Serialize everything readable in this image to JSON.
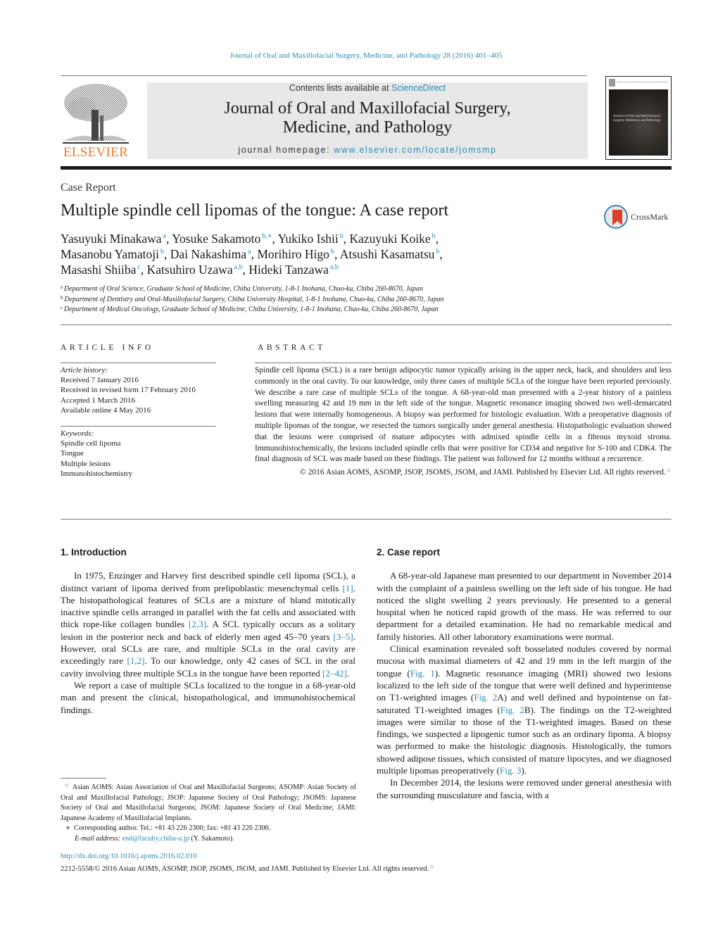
{
  "header": {
    "citation": "Journal of Oral and Maxillofacial Surgery, Medicine, and Pathology 28 (2016) 401–405",
    "publisher_logo_text": "ELSEVIER",
    "contents_prefix": "Contents lists available at ",
    "contents_link": "ScienceDirect",
    "journal_title_line1": "Journal of Oral and Maxillofacial Surgery,",
    "journal_title_line2": "Medicine, and Pathology",
    "homepage_prefix": "journal homepage: ",
    "homepage_link": "www.elsevier.com/locate/jomsmp",
    "cover_title": "Journal of Oral and Maxillofacial Surgery, Medicine, and Pathology"
  },
  "article": {
    "type_label": "Case Report",
    "title": "Multiple spindle cell lipomas of the tongue: A case report",
    "crossmark_label": "CrossMark",
    "authors": [
      {
        "name": "Yasuyuki Minakawa",
        "aff": "a",
        "sep": ", "
      },
      {
        "name": "Yosuke Sakamoto",
        "aff": "b,∗",
        "sep": ", "
      },
      {
        "name": "Yukiko Ishii",
        "aff": "b",
        "sep": ", "
      },
      {
        "name": "Kazuyuki Koike",
        "aff": "b",
        "sep": ","
      },
      {
        "name": "Masanobu Yamatoji",
        "aff": "b",
        "sep": ", "
      },
      {
        "name": "Dai Nakashima",
        "aff": "a",
        "sep": ", "
      },
      {
        "name": "Morihiro Higo",
        "aff": "b",
        "sep": ", "
      },
      {
        "name": "Atsushi Kasamatsu",
        "aff": "b",
        "sep": ","
      },
      {
        "name": "Masashi Shiiba",
        "aff": "c",
        "sep": ", "
      },
      {
        "name": "Katsuhiro Uzawa",
        "aff": "a,b",
        "sep": ", "
      },
      {
        "name": "Hideki Tanzawa",
        "aff": "a,b",
        "sep": ""
      }
    ],
    "affiliations": [
      {
        "key": "a",
        "text": "Department of Oral Science, Graduate School of Medicine, Chiba University, 1-8-1 Inohana, Chuo-ku, Chiba 260-8670, Japan"
      },
      {
        "key": "b",
        "text": "Department of Dentistry and Oral-Maxillofacial Surgery, Chiba University Hospital, 1-8-1 Inohana, Chuo-ku, Chiba 260-8670, Japan"
      },
      {
        "key": "c",
        "text": "Department of Medical Oncology, Graduate School of Medicine, Chiba University, 1-8-1 Inohana, Chuo-ku, Chiba 260-8670, Japan"
      }
    ]
  },
  "article_info": {
    "heading": "ARTICLE INFO",
    "history_label": "Article history:",
    "history": [
      "Received 7 January 2016",
      "Received in revised form 17 February 2016",
      "Accepted 1 March 2016",
      "Available online 4 May 2016"
    ],
    "keywords_label": "Keywords:",
    "keywords": [
      "Spindle cell lipoma",
      "Tongue",
      "Multiple lesions",
      "Immunohistochemistry"
    ]
  },
  "abstract": {
    "heading": "ABSTRACT",
    "text": "Spindle cell lipoma (SCL) is a rare benign adipocytic tumor typically arising in the upper neck, back, and shoulders and less commonly in the oral cavity. To our knowledge, only three cases of multiple SCLs of the tongue have been reported previously. We describe a rare case of multiple SCLs of the tongue. A 68-year-old man presented with a 2-year history of a painless swelling measuring 42 and 19 mm in the left side of the tongue. Magnetic resonance imaging showed two well-demarcated lesions that were internally homogeneous. A biopsy was performed for histologic evaluation. With a preoperative diagnosis of multiple lipomas of the tongue, we resected the tumors surgically under general anesthesia. Histopathologic evaluation showed that the lesions were comprised of mature adipocytes with admixed spindle cells in a fibrous myxoid stroma. Immunohistochemically, the lesions included spindle cells that were positive for CD34 and negative for S-100 and CDK4. The final diagnosis of SCL was made based on these findings. The patient was followed for 12 months without a recurrence.",
    "copyright": "© 2016 Asian AOMS, ASOMP, JSOP, JSOMS, JSOM, and JAMI. Published by Elsevier Ltd. All rights reserved.",
    "star": "☆"
  },
  "introduction": {
    "title": "1.  Introduction",
    "paragraphs": [
      [
        {
          "t": "In 1975, Enzinger and Harvey first described spindle cell lipoma (SCL), a distinct variant of lipoma derived from prelipoblastic mesenchymal cells "
        },
        {
          "t": "[1]",
          "link": true
        },
        {
          "t": ". The histopathological features of SCLs are a mixture of bland mitotically inactive spindle cells arranged in parallel with the fat cells and associated with thick rope-like collagen bundles "
        },
        {
          "t": "[2,3]",
          "link": true
        },
        {
          "t": ". A SCL typically occurs as a solitary lesion in the posterior neck and back of elderly men aged 45–70 years "
        },
        {
          "t": "[3–5]",
          "link": true
        },
        {
          "t": ". However, oral SCLs are rare, and multiple SCLs in the oral cavity are exceedingly rare "
        },
        {
          "t": "[1,2]",
          "link": true
        },
        {
          "t": ". To our knowledge, only 42 cases of SCL in the oral cavity involving three multiple SCLs in the tongue have been reported "
        },
        {
          "t": "[2–42]",
          "link": true
        },
        {
          "t": "."
        }
      ],
      [
        {
          "t": "We report a case of multiple SCLs localized to the tongue in a 68-year-old man and present the clinical, histopathological, and immunohistochemical findings."
        }
      ]
    ]
  },
  "case_report": {
    "title": "2.  Case report",
    "paragraphs": [
      [
        {
          "t": "A 68-year-old Japanese man presented to our department in November 2014 with the complaint of a painless swelling on the left side of his tongue. He had noticed the slight swelling 2 years previously. He presented to a general hospital when he noticed rapid growth of the mass. He was referred to our department for a detailed examination. He had no remarkable medical and family histories. All other laboratory examinations were normal."
        }
      ],
      [
        {
          "t": "Clinical examination revealed soft bosselated nodules covered by normal mucosa with maximal diameters of 42 and 19 mm in the left margin of the tongue ("
        },
        {
          "t": "Fig. 1",
          "link": true
        },
        {
          "t": "). Magnetic resonance imaging (MRI) showed two lesions localized to the left side of the tongue that were well defined and hyperintense on T1-weighted images ("
        },
        {
          "t": "Fig. 2",
          "link": true
        },
        {
          "t": "A) and well defined and hypointense on fat-saturated T1-weighted images ("
        },
        {
          "t": "Fig. 2",
          "link": true
        },
        {
          "t": "B). The findings on the T2-weighted images were similar to those of the T1-weighted images. Based on these findings, we suspected a lipogenic tumor such as an ordinary lipoma. A biopsy was performed to make the histologic diagnosis. Histologically, the tumors showed adipose tissues, which consisted of mature lipocytes, and we diagnosed multiple lipomas preoperatively ("
        },
        {
          "t": "Fig. 3",
          "link": true
        },
        {
          "t": ")."
        }
      ],
      [
        {
          "t": "In December 2014, the lesions were removed under general anesthesia with the surrounding musculature and fascia, with a"
        }
      ]
    ]
  },
  "footnotes": {
    "abbrev_star": "☆",
    "abbrev_text": "Asian AOMS: Asian Association of Oral and Maxillofacial Surgeons; ASOMP: Asian Society of Oral and Maxillofacial Pathology; JSOP: Japanese Society of Oral Pathology; JSOMS: Japanese Society of Oral and Maxillofacial Surgeons; JSOM: Japanese Society of Oral Medicine; JAMI: Japanese Academy of Maxillofacial Implants.",
    "corr_mark": "∗",
    "corr_text": "Corresponding author. Tel.: +81 43 226 2300; fax: +81 43 226 2300.",
    "email_label": "E-mail address:",
    "email": "end@faculty.chiba-u.jp",
    "email_suffix": " (Y. Sakamoto)."
  },
  "footer": {
    "doi": "http://dx.doi.org/10.1016/j.ajoms.2016.02.010",
    "issn_copyright": "2212-5558/© 2016 Asian AOMS, ASOMP, JSOP, JSOMS, JSOM, and JAMI. Published by Elsevier Ltd. All rights reserved.",
    "star": "☆"
  },
  "colors": {
    "link": "#2a8bb5",
    "elsevier_orange": "#f47920",
    "header_box": "#e8e8e8",
    "crossmark_red": "#d9412e",
    "crossmark_blue": "#3f86b5"
  }
}
